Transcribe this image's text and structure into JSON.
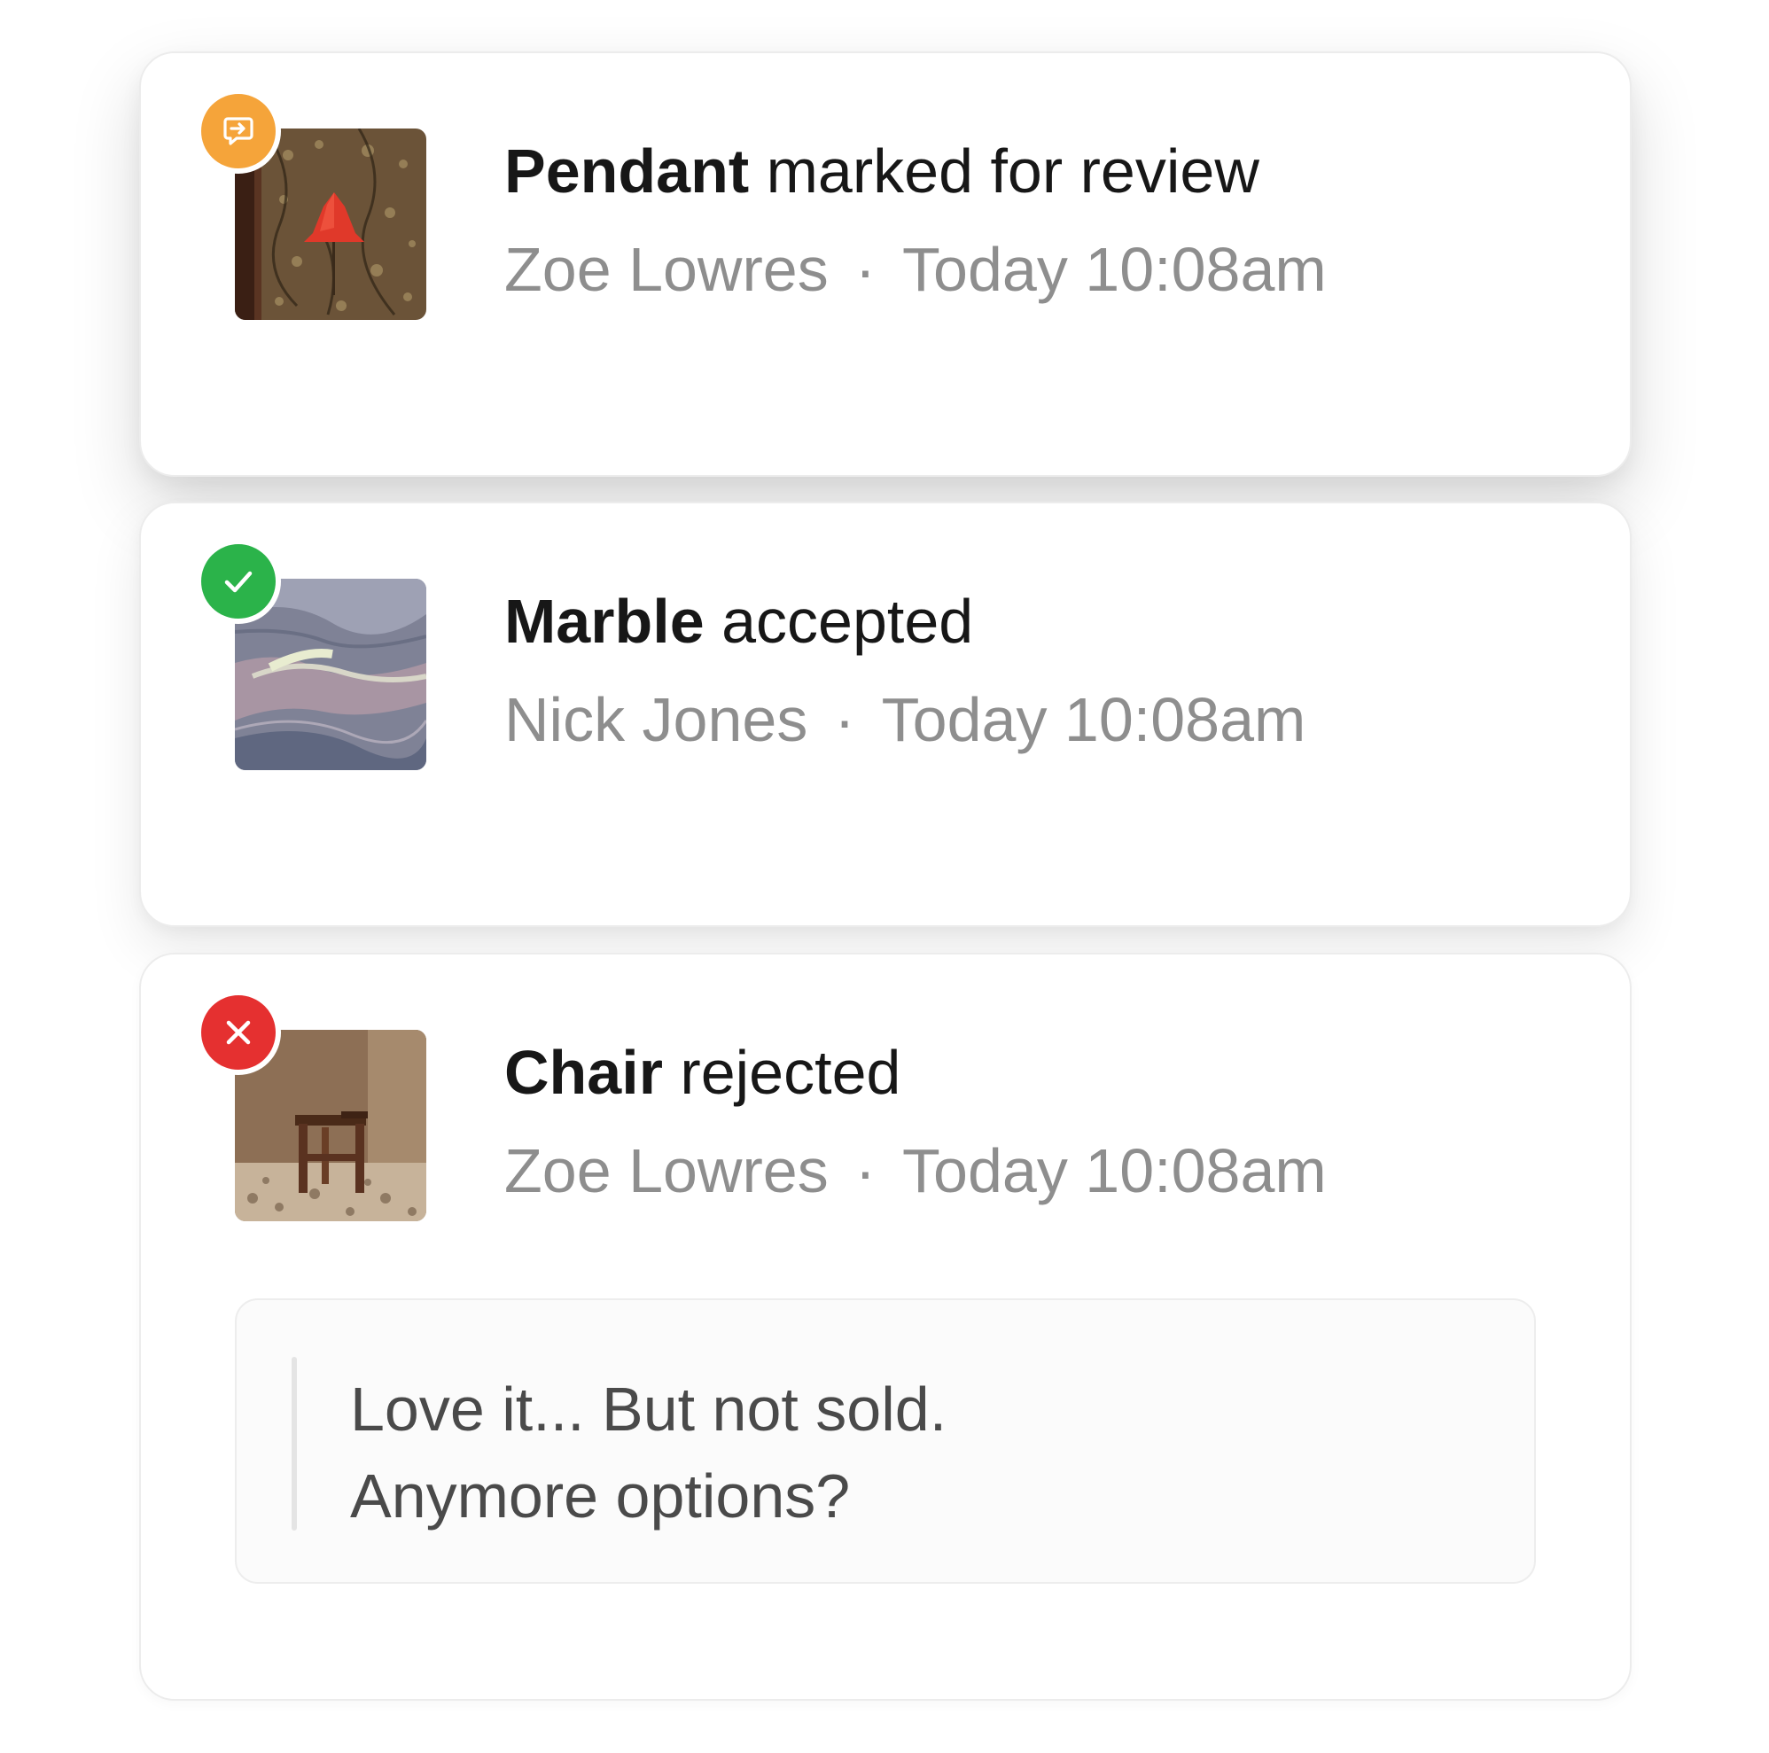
{
  "colors": {
    "review_badge": "#f5a43a",
    "accepted_badge": "#2bb34a",
    "rejected_badge": "#e53030",
    "title_text": "#171717",
    "meta_text": "#8e8e8e"
  },
  "notifications": [
    {
      "item": "Pendant",
      "action": "marked for review",
      "author": "Zoe Lowres",
      "separator": "·",
      "time": "Today 10:08am",
      "status_icon": "review-icon",
      "thumbnail": "pendant-lamp-image"
    },
    {
      "item": "Marble",
      "action": "accepted",
      "author": "Nick Jones",
      "separator": "·",
      "time": "Today 10:08am",
      "status_icon": "check-icon",
      "thumbnail": "marble-image"
    },
    {
      "item": "Chair",
      "action": "rejected",
      "author": "Zoe Lowres",
      "separator": "·",
      "time": "Today 10:08am",
      "status_icon": "close-icon",
      "thumbnail": "chair-image",
      "comment": {
        "line1": "Love it... But not sold.",
        "line2": "Anymore options?"
      }
    }
  ]
}
